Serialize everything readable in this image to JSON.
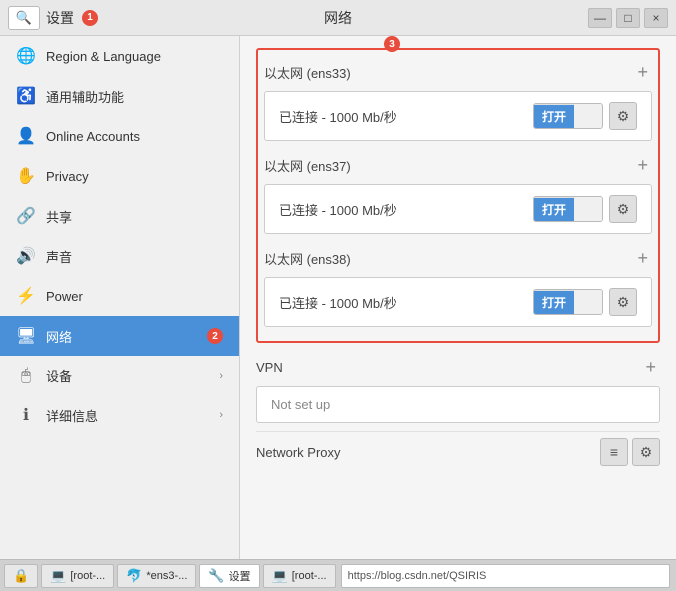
{
  "window": {
    "title": "设置",
    "network_title": "网络",
    "title_badge": "1",
    "controls": [
      "—",
      "□",
      "×"
    ]
  },
  "sidebar": {
    "items": [
      {
        "id": "region",
        "icon": "🌐",
        "label": "Region & Language",
        "active": false,
        "chevron": false
      },
      {
        "id": "accessibility",
        "icon": "👁",
        "label": "通用辅助功能",
        "active": false,
        "chevron": false
      },
      {
        "id": "online-accounts",
        "icon": "👤",
        "label": "Online Accounts",
        "active": false,
        "chevron": false
      },
      {
        "id": "privacy",
        "icon": "✋",
        "label": "Privacy",
        "active": false,
        "chevron": false
      },
      {
        "id": "sharing",
        "icon": "🔗",
        "label": "共享",
        "active": false,
        "chevron": false
      },
      {
        "id": "sound",
        "icon": "🔊",
        "label": "声音",
        "active": false,
        "chevron": false
      },
      {
        "id": "power",
        "icon": "⚡",
        "label": "Power",
        "active": false,
        "chevron": false
      },
      {
        "id": "network",
        "icon": "🖥",
        "label": "网络",
        "active": true,
        "chevron": false,
        "badge": "2"
      },
      {
        "id": "devices",
        "icon": "🖱",
        "label": "设备",
        "active": false,
        "chevron": true
      },
      {
        "id": "details",
        "icon": "ℹ",
        "label": "详细信息",
        "active": false,
        "chevron": true
      }
    ]
  },
  "network": {
    "sections": [
      {
        "id": "ens33",
        "title": "以太网 (ens33)",
        "highlighted": true,
        "badge": "3",
        "connections": [
          {
            "status": "已连接 - 1000 Mb/秒",
            "toggle_on": "打开",
            "has_gear": true
          }
        ]
      },
      {
        "id": "ens37",
        "title": "以太网 (ens37)",
        "highlighted": true,
        "connections": [
          {
            "status": "已连接 - 1000 Mb/秒",
            "toggle_on": "打开",
            "has_gear": true
          }
        ]
      },
      {
        "id": "ens38",
        "title": "以太网 (ens38)",
        "highlighted": true,
        "connections": [
          {
            "status": "已连接 - 1000 Mb/秒",
            "toggle_on": "打开",
            "has_gear": true
          }
        ]
      }
    ],
    "vpn": {
      "title": "VPN",
      "not_set_label": "Not set up"
    },
    "proxy": {
      "title": "Network Proxy"
    }
  },
  "taskbar": {
    "items": [
      {
        "id": "lock",
        "icon": "🔒",
        "label": ""
      },
      {
        "id": "root1",
        "icon": "💻",
        "label": "[root-..."
      },
      {
        "id": "ens3",
        "icon": "🐬",
        "label": "*ens3-..."
      },
      {
        "id": "settings",
        "icon": "🔧",
        "label": "设置"
      },
      {
        "id": "root2",
        "icon": "💻",
        "label": "[root-..."
      }
    ],
    "url": "https://blog.csdn.net/QSIRIS"
  }
}
